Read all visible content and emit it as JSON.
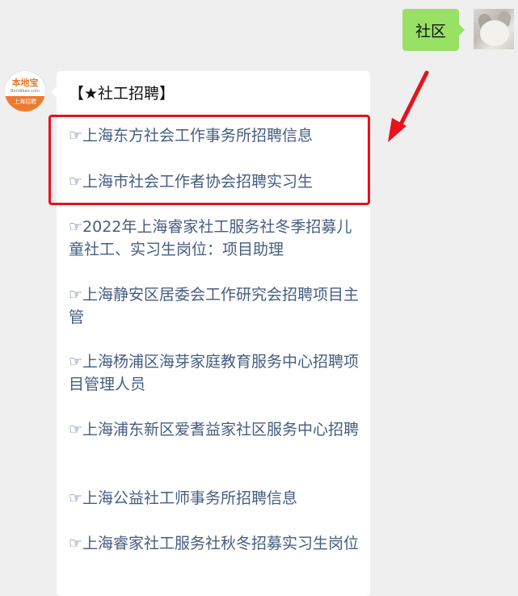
{
  "user_message": {
    "text": "社区"
  },
  "bot_avatar": {
    "brand": "本地宝",
    "domain": "Bendibao.com",
    "band": "上海招聘"
  },
  "bot_message": {
    "title": "【★社工招聘】",
    "links": [
      "☞上海东方社会工作事务所招聘信息",
      "☞上海市社会工作者协会招聘实习生",
      "☞2022年上海睿家社工服务社冬季招募儿童社工、实习生岗位：项目助理",
      "☞上海静安区居委会工作研究会招聘项目主管",
      "☞上海杨浦区海芽家庭教育服务中心招聘项目管理人员",
      "☞上海浦东新区爱耆益家社区服务中心招聘",
      "☞上海公益社工师事务所招聘信息",
      "☞上海睿家社工服务社秋冬招募实习生岗位"
    ]
  },
  "colors": {
    "bubble_green": "#98e165",
    "link": "#465d80",
    "highlight": "#e8111c",
    "background": "#efefef"
  }
}
